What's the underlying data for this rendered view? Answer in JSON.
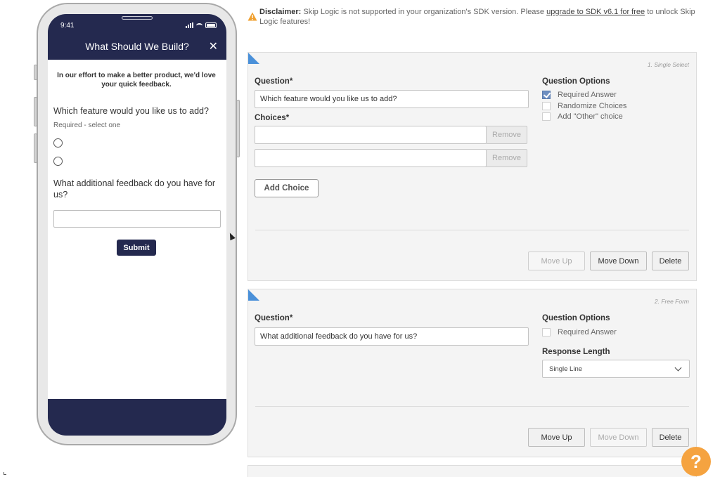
{
  "phone": {
    "time": "9:41",
    "title": "What Should We Build?",
    "close_symbol": "✕",
    "intro": "In our effort to make a better product, we'd love your quick feedback.",
    "question1": "Which feature would you like us to add?",
    "question1_hint": "Required - select one",
    "question2": "What additional feedback do you have for us?",
    "input_value": "",
    "submit_label": "Submit"
  },
  "disclaimer": {
    "label": "Disclaimer:",
    "text_before": " Skip Logic is not supported in your organization's SDK version. Please ",
    "link": "upgrade to SDK v6.1 for free",
    "text_after": " to unlock Skip Logic features!"
  },
  "card1": {
    "type": "1. Single Select",
    "question_label": "Question*",
    "question_value": "Which feature would you like us to add?",
    "choices_label": "Choices*",
    "choices": [
      {
        "value": "",
        "remove": "Remove"
      },
      {
        "value": "",
        "remove": "Remove"
      }
    ],
    "add_choice": "Add Choice",
    "options_title": "Question Options",
    "options": [
      {
        "label": "Required Answer",
        "checked": true
      },
      {
        "label": "Randomize Choices",
        "checked": false
      },
      {
        "label": "Add \"Other\" choice",
        "checked": false
      }
    ],
    "buttons": {
      "move_up": "Move Up",
      "move_down": "Move Down",
      "delete": "Delete"
    }
  },
  "card2": {
    "type": "2. Free Form",
    "question_label": "Question*",
    "question_value": "What additional feedback do you have for us?",
    "options_title": "Question Options",
    "required_label": "Required Answer",
    "required_checked": false,
    "response_length_label": "Response Length",
    "response_length_value": "Single Line",
    "buttons": {
      "move_up": "Move Up",
      "move_down": "Move Down",
      "delete": "Delete"
    }
  },
  "help": {
    "symbol": "?"
  },
  "colors": {
    "navy": "#24294f",
    "accent_blue": "#4a90d9",
    "help_orange": "#f5a340",
    "warning": "#f0a030"
  }
}
